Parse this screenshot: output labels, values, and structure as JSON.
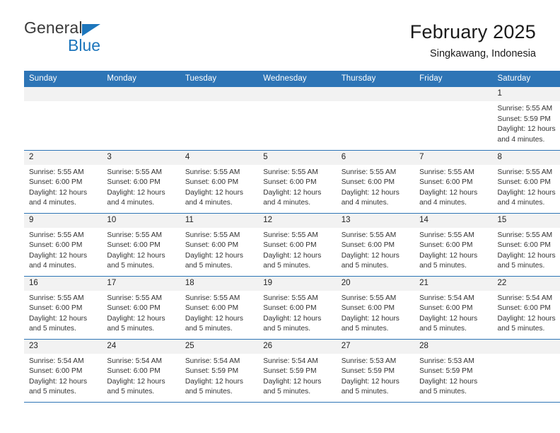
{
  "brand": {
    "name_part1": "General",
    "name_part2": "Blue",
    "triangle_icon": "blue-triangle-logo-mark",
    "accent_color": "#1d76bc"
  },
  "header": {
    "title": "February 2025",
    "location": "Singkawang, Indonesia",
    "header_bg_color": "#2e75b6"
  },
  "weekday_headers": [
    "Sunday",
    "Monday",
    "Tuesday",
    "Wednesday",
    "Thursday",
    "Friday",
    "Saturday"
  ],
  "labels": {
    "sunrise_prefix": "Sunrise:",
    "sunset_prefix": "Sunset:",
    "daylight_prefix": "Daylight:"
  },
  "weeks": [
    [
      {
        "day": "",
        "empty": true
      },
      {
        "day": "",
        "empty": true
      },
      {
        "day": "",
        "empty": true
      },
      {
        "day": "",
        "empty": true
      },
      {
        "day": "",
        "empty": true
      },
      {
        "day": "",
        "empty": true
      },
      {
        "day": "1",
        "sunrise": "Sunrise: 5:55 AM",
        "sunset": "Sunset: 5:59 PM",
        "daylight_line1": "Daylight: 12 hours",
        "daylight_line2": "and 4 minutes."
      }
    ],
    [
      {
        "day": "2",
        "sunrise": "Sunrise: 5:55 AM",
        "sunset": "Sunset: 6:00 PM",
        "daylight_line1": "Daylight: 12 hours",
        "daylight_line2": "and 4 minutes."
      },
      {
        "day": "3",
        "sunrise": "Sunrise: 5:55 AM",
        "sunset": "Sunset: 6:00 PM",
        "daylight_line1": "Daylight: 12 hours",
        "daylight_line2": "and 4 minutes."
      },
      {
        "day": "4",
        "sunrise": "Sunrise: 5:55 AM",
        "sunset": "Sunset: 6:00 PM",
        "daylight_line1": "Daylight: 12 hours",
        "daylight_line2": "and 4 minutes."
      },
      {
        "day": "5",
        "sunrise": "Sunrise: 5:55 AM",
        "sunset": "Sunset: 6:00 PM",
        "daylight_line1": "Daylight: 12 hours",
        "daylight_line2": "and 4 minutes."
      },
      {
        "day": "6",
        "sunrise": "Sunrise: 5:55 AM",
        "sunset": "Sunset: 6:00 PM",
        "daylight_line1": "Daylight: 12 hours",
        "daylight_line2": "and 4 minutes."
      },
      {
        "day": "7",
        "sunrise": "Sunrise: 5:55 AM",
        "sunset": "Sunset: 6:00 PM",
        "daylight_line1": "Daylight: 12 hours",
        "daylight_line2": "and 4 minutes."
      },
      {
        "day": "8",
        "sunrise": "Sunrise: 5:55 AM",
        "sunset": "Sunset: 6:00 PM",
        "daylight_line1": "Daylight: 12 hours",
        "daylight_line2": "and 4 minutes."
      }
    ],
    [
      {
        "day": "9",
        "sunrise": "Sunrise: 5:55 AM",
        "sunset": "Sunset: 6:00 PM",
        "daylight_line1": "Daylight: 12 hours",
        "daylight_line2": "and 4 minutes."
      },
      {
        "day": "10",
        "sunrise": "Sunrise: 5:55 AM",
        "sunset": "Sunset: 6:00 PM",
        "daylight_line1": "Daylight: 12 hours",
        "daylight_line2": "and 5 minutes."
      },
      {
        "day": "11",
        "sunrise": "Sunrise: 5:55 AM",
        "sunset": "Sunset: 6:00 PM",
        "daylight_line1": "Daylight: 12 hours",
        "daylight_line2": "and 5 minutes."
      },
      {
        "day": "12",
        "sunrise": "Sunrise: 5:55 AM",
        "sunset": "Sunset: 6:00 PM",
        "daylight_line1": "Daylight: 12 hours",
        "daylight_line2": "and 5 minutes."
      },
      {
        "day": "13",
        "sunrise": "Sunrise: 5:55 AM",
        "sunset": "Sunset: 6:00 PM",
        "daylight_line1": "Daylight: 12 hours",
        "daylight_line2": "and 5 minutes."
      },
      {
        "day": "14",
        "sunrise": "Sunrise: 5:55 AM",
        "sunset": "Sunset: 6:00 PM",
        "daylight_line1": "Daylight: 12 hours",
        "daylight_line2": "and 5 minutes."
      },
      {
        "day": "15",
        "sunrise": "Sunrise: 5:55 AM",
        "sunset": "Sunset: 6:00 PM",
        "daylight_line1": "Daylight: 12 hours",
        "daylight_line2": "and 5 minutes."
      }
    ],
    [
      {
        "day": "16",
        "sunrise": "Sunrise: 5:55 AM",
        "sunset": "Sunset: 6:00 PM",
        "daylight_line1": "Daylight: 12 hours",
        "daylight_line2": "and 5 minutes."
      },
      {
        "day": "17",
        "sunrise": "Sunrise: 5:55 AM",
        "sunset": "Sunset: 6:00 PM",
        "daylight_line1": "Daylight: 12 hours",
        "daylight_line2": "and 5 minutes."
      },
      {
        "day": "18",
        "sunrise": "Sunrise: 5:55 AM",
        "sunset": "Sunset: 6:00 PM",
        "daylight_line1": "Daylight: 12 hours",
        "daylight_line2": "and 5 minutes."
      },
      {
        "day": "19",
        "sunrise": "Sunrise: 5:55 AM",
        "sunset": "Sunset: 6:00 PM",
        "daylight_line1": "Daylight: 12 hours",
        "daylight_line2": "and 5 minutes."
      },
      {
        "day": "20",
        "sunrise": "Sunrise: 5:55 AM",
        "sunset": "Sunset: 6:00 PM",
        "daylight_line1": "Daylight: 12 hours",
        "daylight_line2": "and 5 minutes."
      },
      {
        "day": "21",
        "sunrise": "Sunrise: 5:54 AM",
        "sunset": "Sunset: 6:00 PM",
        "daylight_line1": "Daylight: 12 hours",
        "daylight_line2": "and 5 minutes."
      },
      {
        "day": "22",
        "sunrise": "Sunrise: 5:54 AM",
        "sunset": "Sunset: 6:00 PM",
        "daylight_line1": "Daylight: 12 hours",
        "daylight_line2": "and 5 minutes."
      }
    ],
    [
      {
        "day": "23",
        "sunrise": "Sunrise: 5:54 AM",
        "sunset": "Sunset: 6:00 PM",
        "daylight_line1": "Daylight: 12 hours",
        "daylight_line2": "and 5 minutes."
      },
      {
        "day": "24",
        "sunrise": "Sunrise: 5:54 AM",
        "sunset": "Sunset: 6:00 PM",
        "daylight_line1": "Daylight: 12 hours",
        "daylight_line2": "and 5 minutes."
      },
      {
        "day": "25",
        "sunrise": "Sunrise: 5:54 AM",
        "sunset": "Sunset: 5:59 PM",
        "daylight_line1": "Daylight: 12 hours",
        "daylight_line2": "and 5 minutes."
      },
      {
        "day": "26",
        "sunrise": "Sunrise: 5:54 AM",
        "sunset": "Sunset: 5:59 PM",
        "daylight_line1": "Daylight: 12 hours",
        "daylight_line2": "and 5 minutes."
      },
      {
        "day": "27",
        "sunrise": "Sunrise: 5:53 AM",
        "sunset": "Sunset: 5:59 PM",
        "daylight_line1": "Daylight: 12 hours",
        "daylight_line2": "and 5 minutes."
      },
      {
        "day": "28",
        "sunrise": "Sunrise: 5:53 AM",
        "sunset": "Sunset: 5:59 PM",
        "daylight_line1": "Daylight: 12 hours",
        "daylight_line2": "and 5 minutes."
      },
      {
        "day": "",
        "empty": true
      }
    ]
  ]
}
